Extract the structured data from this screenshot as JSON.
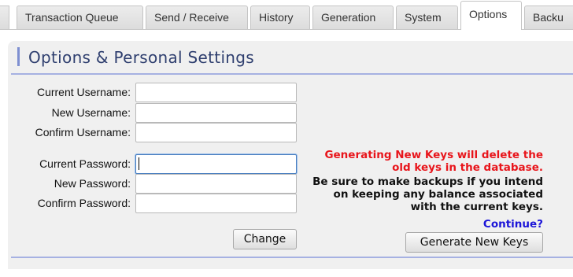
{
  "tabs": [
    {
      "label": "Transaction Queue",
      "active": false
    },
    {
      "label": "Send / Receive",
      "active": false
    },
    {
      "label": "History",
      "active": false
    },
    {
      "label": "Generation",
      "active": false
    },
    {
      "label": "System",
      "active": false
    },
    {
      "label": "Options",
      "active": true
    },
    {
      "label": "Backu",
      "active": false
    }
  ],
  "panel": {
    "title": "Options & Personal Settings"
  },
  "username_form": {
    "current_label": "Current Username:",
    "new_label": "New Username:",
    "confirm_label": "Confirm Username:",
    "current_value": "",
    "new_value": "",
    "confirm_value": ""
  },
  "password_form": {
    "current_label": "Current Password:",
    "new_label": "New Password:",
    "confirm_label": "Confirm Password:",
    "current_value": "",
    "new_value": "",
    "confirm_value": "",
    "change_label": "Change"
  },
  "keys": {
    "warning_line1": "Generating New Keys will delete the",
    "warning_line2": "old keys in the database.",
    "info_line1": "Be sure to make backups if you intend",
    "info_line2": "on keeping any balance associated",
    "info_line3": "with the current keys.",
    "continue": "Continue?",
    "generate_label": "Generate New Keys"
  },
  "colors": {
    "warning": "#e8151b",
    "continue": "#1b14d8",
    "heading": "#2f3f6f",
    "accent": "#7e8fd1"
  }
}
